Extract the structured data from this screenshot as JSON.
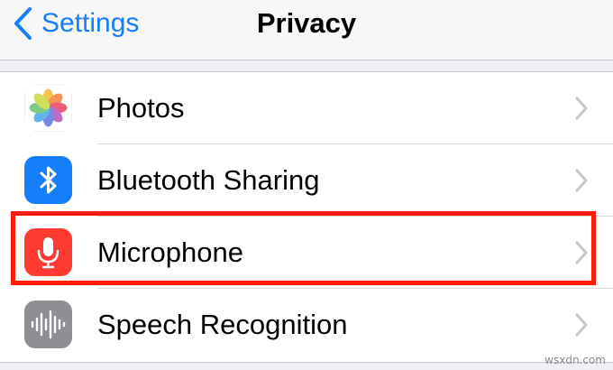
{
  "navbar": {
    "back_label": "Settings",
    "title": "Privacy"
  },
  "rows": [
    {
      "label": "Photos",
      "icon": "photos-icon"
    },
    {
      "label": "Bluetooth Sharing",
      "icon": "bluetooth-icon",
      "icon_color": "#147efb"
    },
    {
      "label": "Microphone",
      "icon": "microphone-icon",
      "icon_color": "#fd3b30",
      "highlighted": true
    },
    {
      "label": "Speech Recognition",
      "icon": "speech-recognition-icon",
      "icon_color": "#8e8e93"
    }
  ],
  "highlight_color": "#ff1d0a",
  "accent_color": "#157efb",
  "watermark": "wsxdn.com"
}
